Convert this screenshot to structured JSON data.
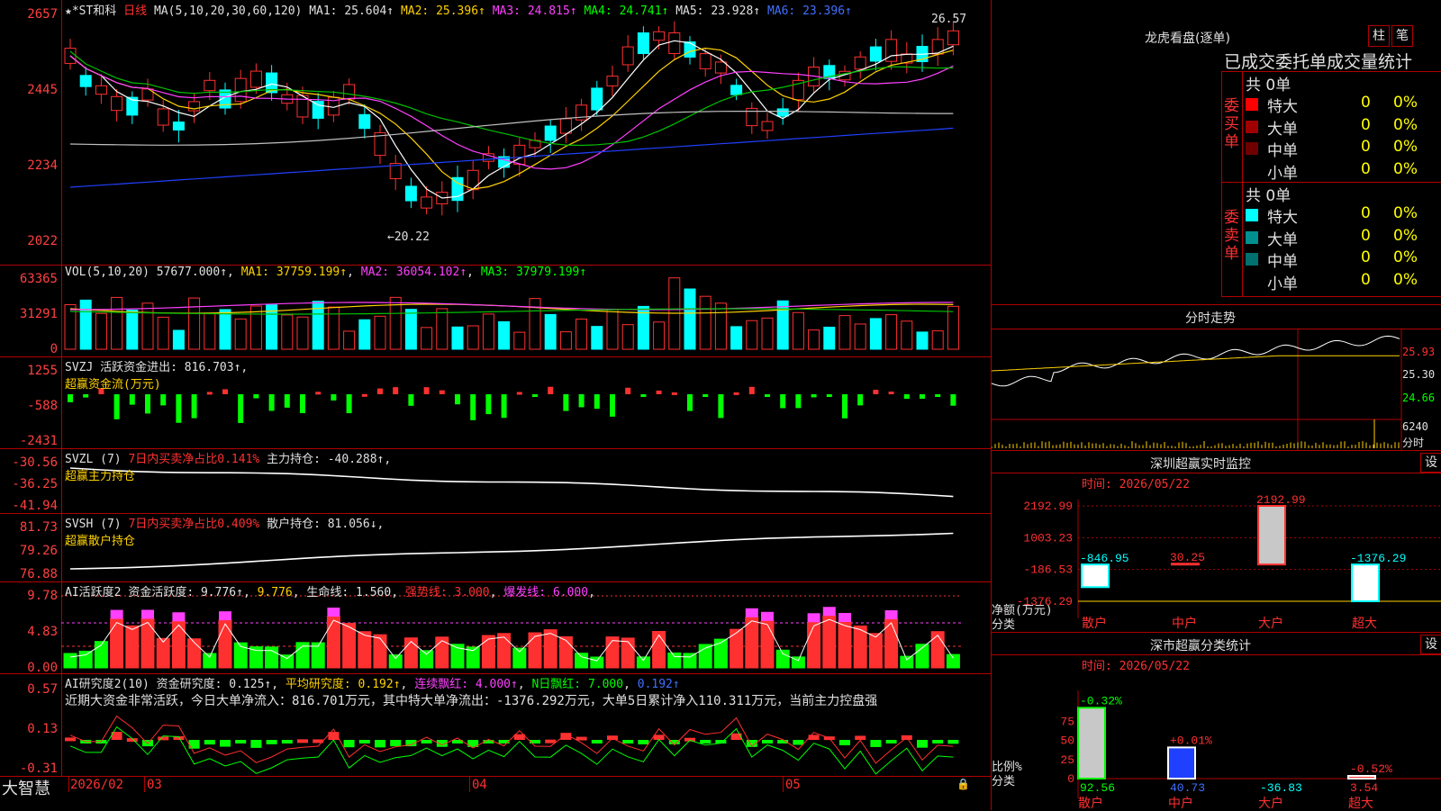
{
  "app": {
    "logo": "大智慧"
  },
  "colors": {
    "up": "#ff3030",
    "down": "#00ffff",
    "bg": "#000000",
    "border": "#b00000",
    "ma1": "#ffffff",
    "ma2": "#ffd200",
    "ma3": "#ff40ff",
    "ma4": "#00c000",
    "ma5": "#c0c0c0",
    "ma6": "#2040ff"
  },
  "kline": {
    "stock_name": "★*ST和科",
    "period": "日线",
    "ma_header": "MA(5,10,20,30,60,120)",
    "ma1": "MA1: 25.604↑",
    "ma2": "MA2: 25.396↑",
    "ma3": "MA3: 24.815↑",
    "ma4": "MA4: 24.741↑",
    "ma5": "MA5: 23.928↑",
    "ma6": "MA6: 23.396↑",
    "yticks": [
      "2657",
      "2445",
      "2234",
      "2022"
    ],
    "high_label": "26.57",
    "low_label": "←20.22"
  },
  "vol": {
    "header": "VOL(5,10,20)",
    "value": "57677.000↑",
    "ma1": "MA1: 37759.199↑",
    "ma2": "MA2: 36054.102↑",
    "ma3": "MA3: 37979.199↑",
    "yticks": [
      "63365",
      "31291",
      "0"
    ]
  },
  "svzj": {
    "header": "SVZJ",
    "text": "活跃资金进出: 816.703↑",
    "sub": "超赢资金流(万元)",
    "yticks": [
      "1255",
      "-588",
      "-2431"
    ]
  },
  "svzl": {
    "header": "SVZL (7)",
    "text_red": "7日内买卖净占比0.141%",
    "text": "主力持仓: -40.288↑",
    "sub": "超赢主力持仓",
    "yticks": [
      "-30.56",
      "-36.25",
      "-41.94"
    ]
  },
  "svsh": {
    "header": "SVSH (7)",
    "text_red": "7日内买卖净占比0.409%",
    "text": "散户持仓: 81.056↓",
    "sub": "超赢散户持仓",
    "yticks": [
      "81.73",
      "79.26",
      "76.88"
    ]
  },
  "ai1": {
    "header": "AI活跃度2",
    "t1": "资金活跃度: 9.776↑",
    "t2": "9.776",
    "t3": "生命线: 1.560",
    "t4": "强势线: 3.000",
    "t5": "爆发线: 6.000",
    "yticks": [
      "9.78",
      "4.83",
      "0.00"
    ]
  },
  "ai2": {
    "header": "AI研究度2(10)",
    "t1": "资金研究度: 0.125↑",
    "t2": "平均研究度: 0.192↑",
    "t3": "连续飘红: 4.000↑",
    "t4": "N日飘红: 7.000",
    "t5": "0.192↑",
    "desc": "近期大资金非常活跃，今日大单净流入：816.701万元，其中特大单净流出：-1376.292万元，大单5日累计净入110.311万元，当前主力控盘强",
    "yticks": [
      "0.57",
      "0.13",
      "-0.31"
    ]
  },
  "xaxis": {
    "labels": [
      "2026/02",
      "03",
      "04",
      "05"
    ]
  },
  "longhu": {
    "title": "龙虎看盘(逐单)",
    "btn_bar": "柱",
    "btn_pen": "笔",
    "subtitle": "已成交委托单成交量统计",
    "buy": {
      "side": "委买单",
      "total": "共 0单",
      "rows": [
        {
          "name": "特大",
          "count": "0",
          "pct": "0%"
        },
        {
          "name": "大单",
          "count": "0",
          "pct": "0%"
        },
        {
          "name": "中单",
          "count": "0",
          "pct": "0%"
        },
        {
          "name": "小单",
          "count": "0",
          "pct": "0%"
        }
      ]
    },
    "sell": {
      "side": "委卖单",
      "total": "共 0单",
      "rows": [
        {
          "name": "特大",
          "count": "0",
          "pct": "0%"
        },
        {
          "name": "大单",
          "count": "0",
          "pct": "0%"
        },
        {
          "name": "中单",
          "count": "0",
          "pct": "0%"
        },
        {
          "name": "小单",
          "count": "0",
          "pct": "0%"
        }
      ]
    }
  },
  "intraday": {
    "title": "分时走势",
    "yticks": [
      "25.93",
      "25.30",
      "24.66"
    ],
    "vol_label": "6240",
    "vol_unit": "分时"
  },
  "sz_monitor": {
    "title": "深圳超赢实时监控",
    "btn": "设",
    "time": "时间: 2026/05/22",
    "yticks": [
      "2192.99",
      "1003.23",
      "-186.53",
      "-1376.29"
    ],
    "ylabel": "净额(万元)",
    "xlabel": "分类",
    "bars": [
      {
        "name": "散户",
        "value": -846.95,
        "label": "-846.95"
      },
      {
        "name": "中户",
        "value": 30.25,
        "label": "30.25"
      },
      {
        "name": "大户",
        "value": 2192.99,
        "label": "2192.99"
      },
      {
        "name": "超大",
        "value": -1376.29,
        "label": "-1376.29"
      }
    ]
  },
  "sz_class": {
    "title": "深市超赢分类统计",
    "btn": "设",
    "time": "时间: 2026/05/22",
    "yticks": [
      "75",
      "50",
      "25",
      "0"
    ],
    "ylabel": "比例%",
    "xlabel": "分类",
    "bars": [
      {
        "name": "散户",
        "top": "-0.32%",
        "value": 92.56,
        "label": "92.56"
      },
      {
        "name": "中户",
        "top": "+0.01%",
        "value": 40.73,
        "label": "40.73"
      },
      {
        "name": "大户",
        "top": "",
        "value": -36.83,
        "label": "-36.83"
      },
      {
        "name": "超大",
        "top": "-0.52%",
        "value": 3.54,
        "label": "3.54"
      }
    ]
  }
}
